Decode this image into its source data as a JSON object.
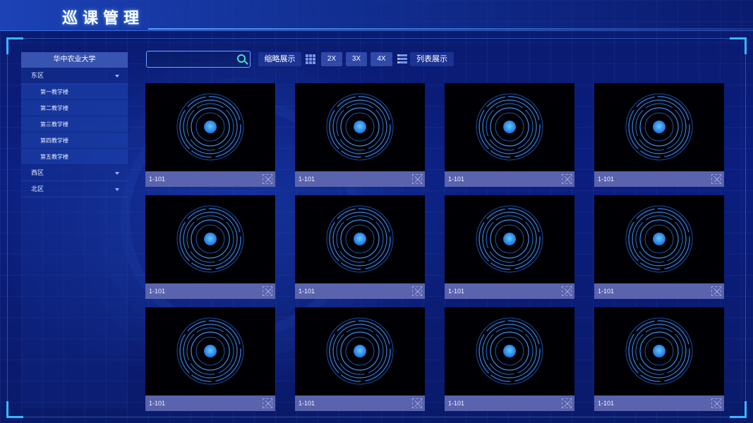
{
  "header": {
    "title": "巡课管理"
  },
  "sidebar": {
    "root": "华中农业大学",
    "groups": [
      {
        "label": "东区",
        "children": [
          "第一教学楼",
          "第二教学楼",
          "第三教学楼",
          "第四教学楼",
          "第五教学楼"
        ]
      },
      {
        "label": "西区"
      },
      {
        "label": "北区"
      }
    ]
  },
  "toolbar": {
    "search_placeholder": "",
    "thumbnail_label": "缩略展示",
    "zoom_2x": "2X",
    "zoom_3x": "3X",
    "zoom_4x": "4X",
    "list_label": "列表展示"
  },
  "tiles": [
    {
      "label": "1-101"
    },
    {
      "label": "1-101"
    },
    {
      "label": "1-101"
    },
    {
      "label": "1-101"
    },
    {
      "label": "1-101"
    },
    {
      "label": "1-101"
    },
    {
      "label": "1-101"
    },
    {
      "label": "1-101"
    },
    {
      "label": "1-101"
    },
    {
      "label": "1-101"
    },
    {
      "label": "1-101"
    },
    {
      "label": "1-101"
    }
  ],
  "colors": {
    "accent": "#38b6ff",
    "tile_bar": "#5a63ad",
    "search_icon": "#46e0c8"
  },
  "icons": {
    "search": "search-icon",
    "thumbnail": "grid-icon",
    "list": "list-icon",
    "expand": "expand-icon"
  }
}
